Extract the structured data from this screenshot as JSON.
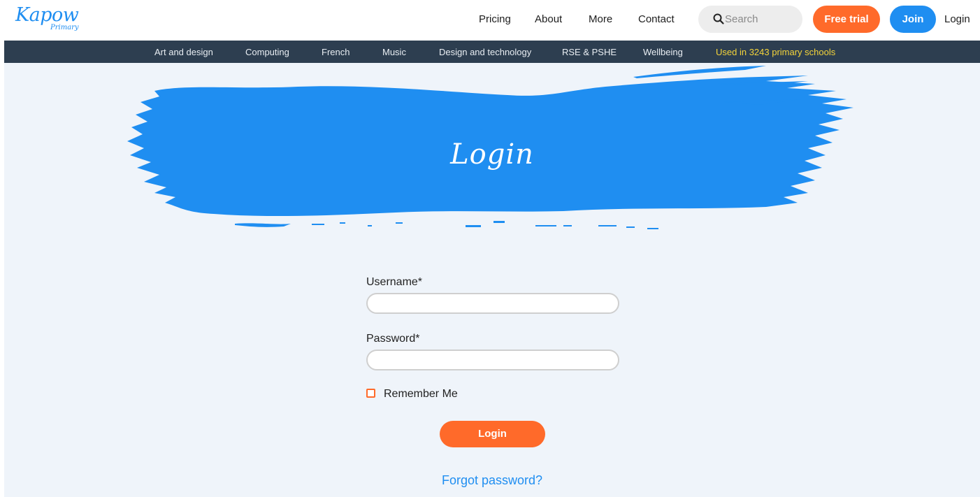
{
  "header": {
    "logo_text": "Kapow",
    "logo_subtext": "Primary",
    "nav": [
      "Pricing",
      "About",
      "More",
      "Contact"
    ],
    "search_placeholder": "Search",
    "free_trial": "Free trial",
    "join": "Join",
    "login": "Login"
  },
  "subnav": {
    "items": [
      "Art and design",
      "Computing",
      "French",
      "Music",
      "Design and technology",
      "RSE & PSHE",
      "Wellbeing"
    ],
    "highlight": "Used in 3243 primary schools"
  },
  "hero": {
    "title": "Login"
  },
  "form": {
    "username_label": "Username*",
    "password_label": "Password*",
    "remember_label": "Remember Me",
    "submit_label": "Login",
    "forgot_label": "Forgot password?"
  },
  "colors": {
    "brand_blue": "#1f8ef1",
    "accent_orange": "#ff6a2a",
    "subnav_bg": "#2d3e50",
    "highlight_yellow": "#f4d43a",
    "page_bg": "#eff4fa"
  }
}
